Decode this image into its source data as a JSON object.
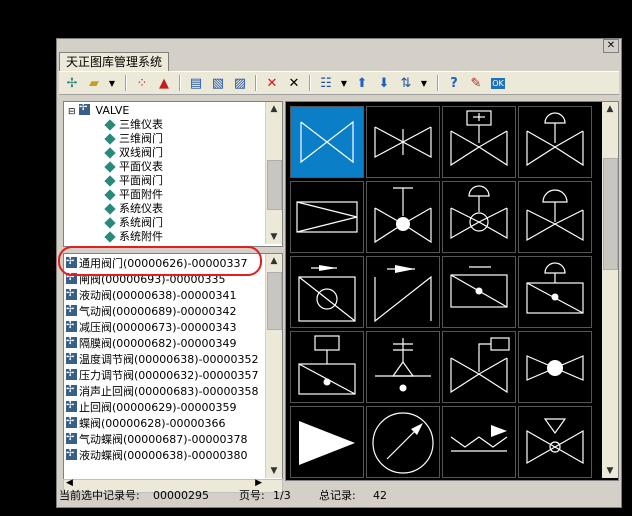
{
  "window": {
    "title": "天正图库管理系统"
  },
  "toolbar": {
    "icons": [
      "new-library-icon",
      "open-folder-icon",
      "dropdown-icon",
      "select-icon",
      "triangle-icon",
      "import-icon",
      "export-icon",
      "copy-icon",
      "delete-red-icon",
      "delete-icon",
      "view-mode-icon",
      "move-up-icon",
      "move-down-icon",
      "sort-icon",
      "help-icon",
      "edit-icon",
      "ok-icon"
    ]
  },
  "tree": {
    "root": "VALVE",
    "items": [
      "三维仪表",
      "三维阀门",
      "双线阀门",
      "平面仪表",
      "平面阀门",
      "平面附件",
      "系统仪表",
      "系统阀门",
      "系统附件"
    ]
  },
  "list": {
    "items": [
      "通用阀门(00000626)-00000337",
      "闸阀(00000693)-00000335",
      "液动阀(00000638)-00000341",
      "气动阀(00000689)-00000342",
      "减压阀(00000673)-00000343",
      "隔膜阀(00000682)-00000349",
      "温度调节阀(00000638)-00000352",
      "压力调节阀(00000632)-00000357",
      "消声止回阀(00000683)-00000358",
      "止回阀(00000629)-00000359",
      "蝶阀(00000628)-00000366",
      "气动蝶阀(00000687)-00000378",
      "液动蝶阀(00000638)-00000380"
    ]
  },
  "status": {
    "selected_label": "当前选中记录号:",
    "selected_value": "00000295",
    "page_label": "页号:",
    "page_value": "1/3",
    "total_label": "总记录:",
    "total_value": "42"
  },
  "colors": {
    "selected_cell": "#0a7fc8",
    "annotation": "#e02020"
  }
}
